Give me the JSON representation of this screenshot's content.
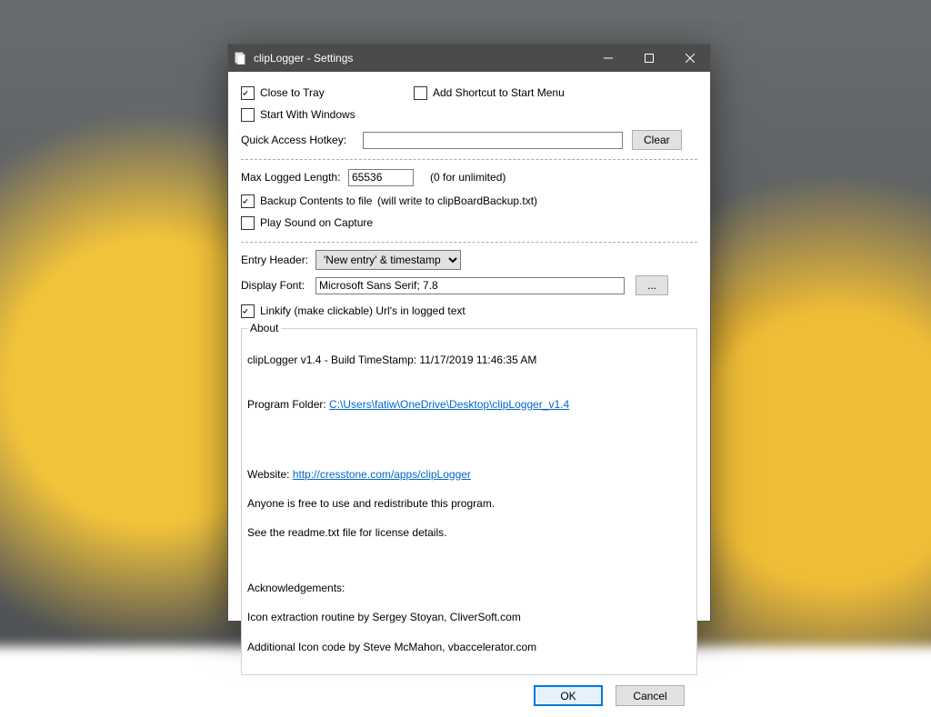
{
  "window": {
    "title": "clipLogger - Settings"
  },
  "opts": {
    "close_to_tray": "Close to Tray",
    "add_shortcut": "Add Shortcut to Start Menu",
    "start_with_windows": "Start With Windows",
    "quick_hotkey_label": "Quick Access Hotkey:",
    "quick_hotkey_value": "",
    "clear": "Clear",
    "max_logged_label": "Max Logged Length:",
    "max_logged_value": "65536",
    "max_logged_note": "(0 for unlimited)",
    "backup_label": "Backup Contents to file",
    "backup_note": "(will write to clipBoardBackup.txt)",
    "play_sound": "Play Sound on Capture",
    "entry_header_label": "Entry Header:",
    "entry_header_value": "'New entry' & timestamp",
    "display_font_label": "Display Font:",
    "display_font_value": "Microsoft Sans Serif; 7.8",
    "font_browse": "...",
    "linkify": "Linkify (make clickable) Url's in logged text"
  },
  "about": {
    "legend": "About",
    "line1": "clipLogger v1.4   -   Build TimeStamp: 11/17/2019 11:46:35 AM",
    "folder_label": "Program Folder: ",
    "folder_link": "C:\\Users\\fatiw\\OneDrive\\Desktop\\clipLogger_v1.4",
    "website_label": "Website: ",
    "website_link": "http://cresstone.com/apps/clipLogger",
    "redistribute": "Anyone is free to use and redistribute this program.",
    "readme": "See the readme.txt file for license details.",
    "ack_header": "Acknowledgements:",
    "ack1": "Icon extraction routine by Sergey Stoyan, CliverSoft.com",
    "ack2": "Additional Icon code by Steve McMahon, vbaccelerator.com"
  },
  "footer": {
    "ok": "OK",
    "cancel": "Cancel"
  }
}
